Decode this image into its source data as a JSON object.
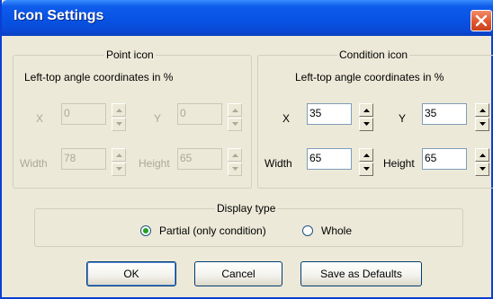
{
  "window": {
    "title": "Icon Settings"
  },
  "point_icon": {
    "legend": "Point icon",
    "subtitle": "Left-top angle coordinates in %",
    "x_label": "X",
    "x_value": "0",
    "y_label": "Y",
    "y_value": "0",
    "width_label": "Width",
    "width_value": "78",
    "height_label": "Height",
    "height_value": "65"
  },
  "condition_icon": {
    "legend": "Condition icon",
    "subtitle": "Left-top angle coordinates in %",
    "x_label": "X",
    "x_value": "35",
    "y_label": "Y",
    "y_value": "35",
    "width_label": "Width",
    "width_value": "65",
    "height_label": "Height",
    "height_value": "65"
  },
  "display_type": {
    "legend": "Display type",
    "partial_label": "Partial (only condition)",
    "whole_label": "Whole",
    "selected": "partial"
  },
  "buttons": {
    "ok": "OK",
    "cancel": "Cancel",
    "save_defaults": "Save as Defaults"
  },
  "colors": {
    "titlebar": "#0853e4",
    "dialog_bg": "#ece9d8",
    "close_button": "#e2552c",
    "radio_dot": "#21a121"
  }
}
